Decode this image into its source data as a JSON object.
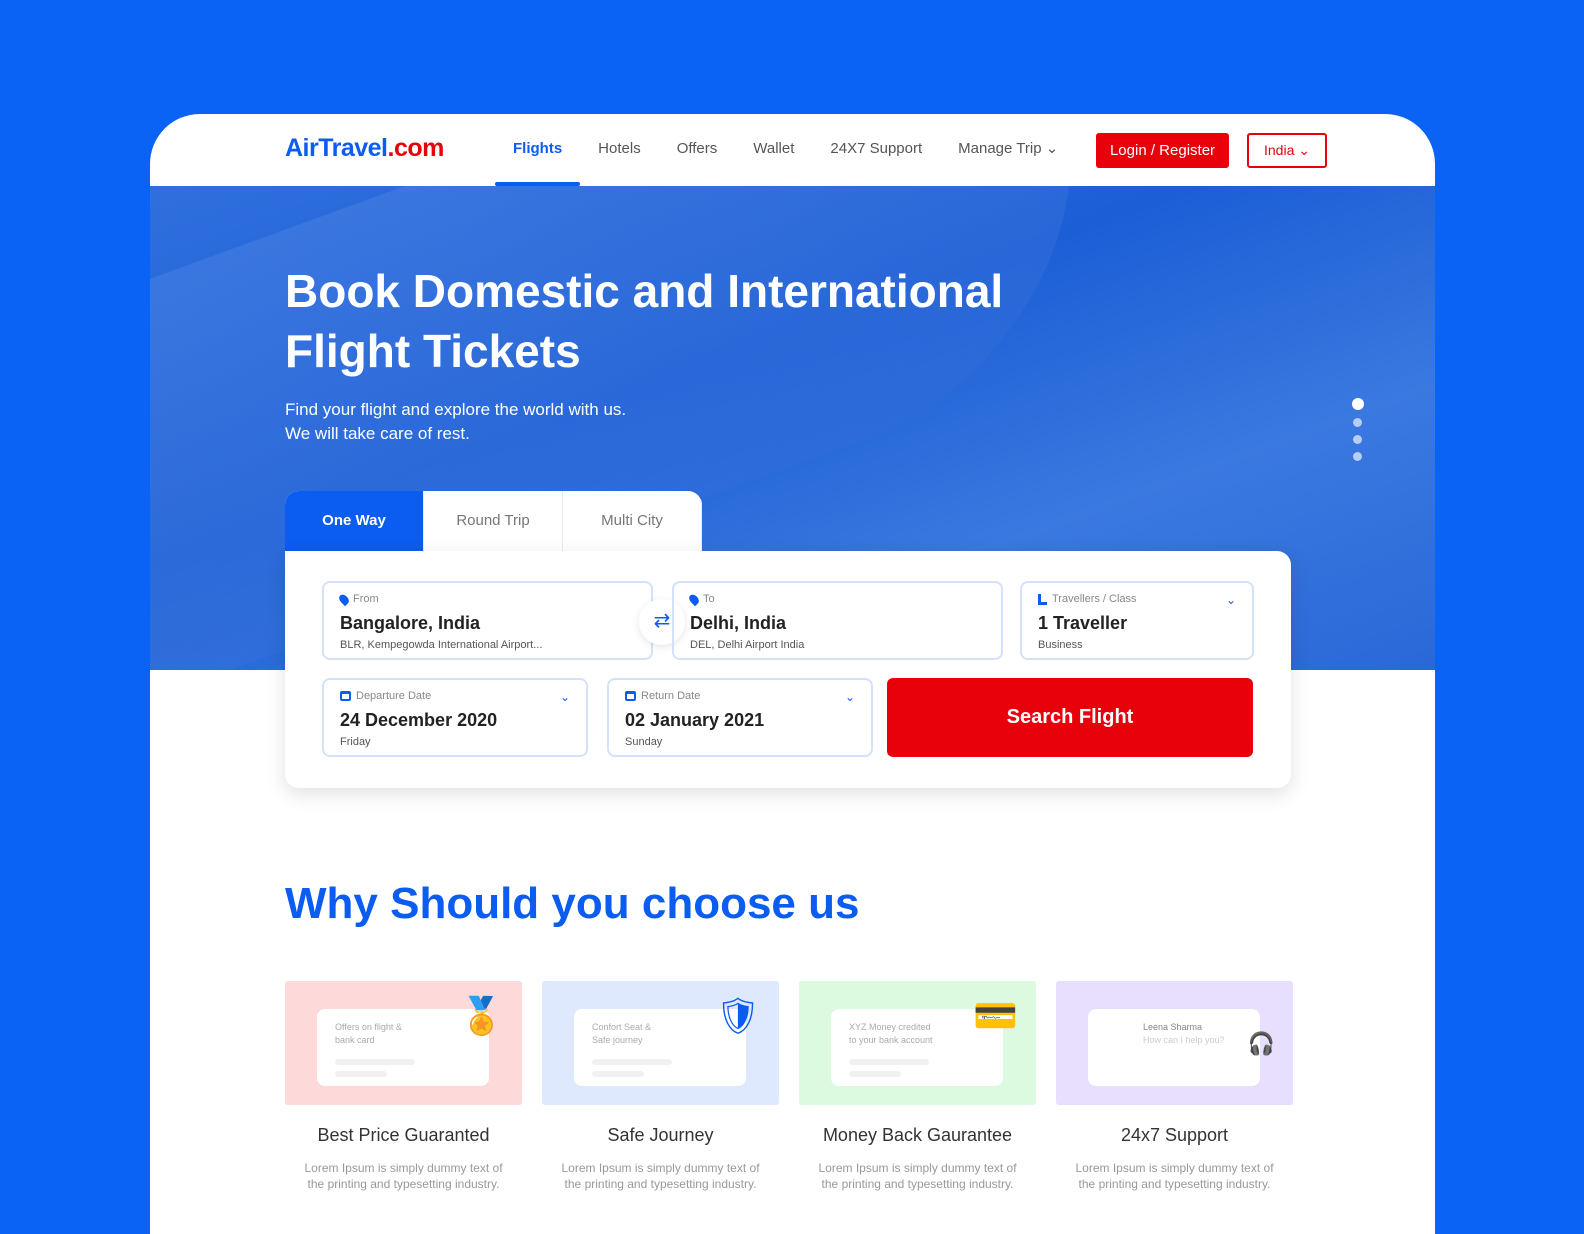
{
  "brand": {
    "name_a": "AirTravel",
    "name_b": ".com"
  },
  "nav": {
    "items": [
      "Flights",
      "Hotels",
      "Offers",
      "Wallet",
      "24X7 Support",
      "Manage Trip"
    ],
    "login": "Login / Register",
    "country": "India"
  },
  "hero": {
    "title": "Book Domestic and International Flight Tickets",
    "subtitle_1": "Find your flight and explore the world with us.",
    "subtitle_2": "We will take care of rest."
  },
  "tabs": [
    "One Way",
    "Round Trip",
    "Multi City"
  ],
  "form": {
    "from": {
      "label": "From",
      "value": "Bangalore, India",
      "sub": "BLR, Kempegowda International Airport..."
    },
    "to": {
      "label": "To",
      "value": "Delhi, India",
      "sub": "DEL, Delhi Airport India"
    },
    "travellers": {
      "label": "Travellers / Class",
      "value": "1 Traveller",
      "sub": "Business"
    },
    "departure": {
      "label": "Departure Date",
      "value": "24 December 2020",
      "sub": "Friday"
    },
    "return": {
      "label": "Return Date",
      "value": "02 January 2021",
      "sub": "Sunday"
    },
    "search": "Search Flight"
  },
  "why": {
    "title": "Why Should you choose us"
  },
  "features": [
    {
      "title": "Best Price Guaranted",
      "card_1": "Offers on flight &",
      "card_2": "bank card",
      "desc": "Lorem Ipsum is simply dummy text of the printing and typesetting industry.",
      "bg": "#fdd9d9"
    },
    {
      "title": "Safe Journey",
      "card_1": "Confort Seat &",
      "card_2": "Safe journey",
      "desc": "Lorem Ipsum is simply dummy text of the printing and typesetting industry.",
      "bg": "#dfe9fd"
    },
    {
      "title": "Money Back Gaurantee",
      "card_1": "XYZ Money credited",
      "card_2": "to your bank account",
      "desc": "Lorem Ipsum is simply dummy text of the printing and typesetting industry.",
      "bg": "#dcfadf"
    },
    {
      "title": "24x7 Support",
      "card_1": "Leena Sharma",
      "card_2": "How can I help you?",
      "desc": "Lorem Ipsum is simply dummy text of the printing and typesetting industry.",
      "bg": "#e8defd"
    }
  ],
  "colors": {
    "brand_blue": "#0b5cf0",
    "accent_red": "#e8000a"
  }
}
